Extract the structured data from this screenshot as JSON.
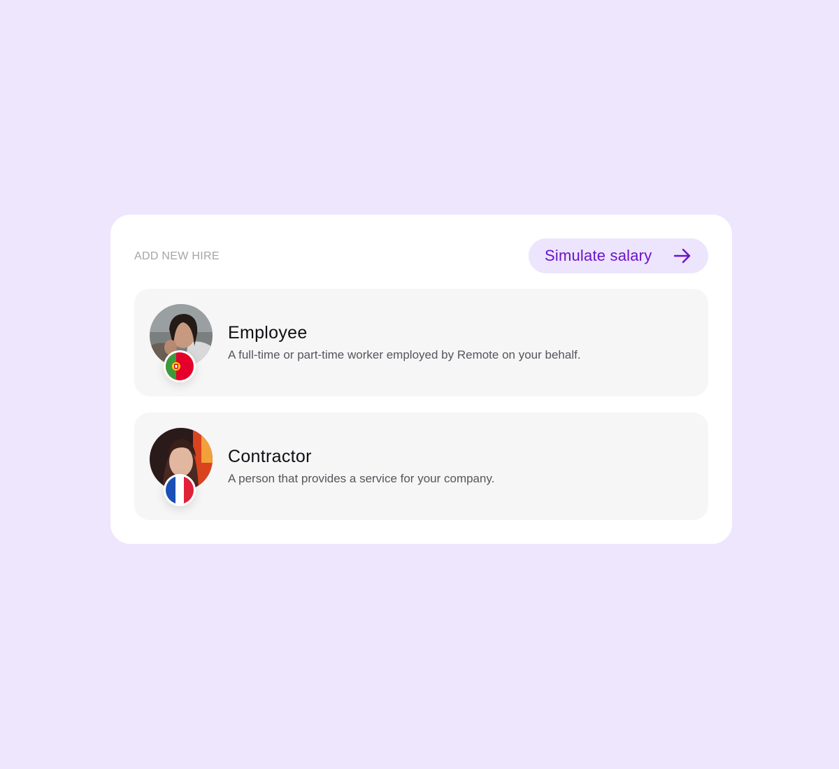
{
  "header": {
    "title": "ADD NEW HIRE",
    "simulate_label": "Simulate salary",
    "simulate_icon": "arrow-right-icon"
  },
  "options": [
    {
      "title": "Employee",
      "description": "A full-time or part-time worker employed by Remote on your behalf.",
      "flag": "portugal-flag-icon"
    },
    {
      "title": "Contractor",
      "description": "A person that provides a service for your company.",
      "flag": "france-flag-icon"
    }
  ],
  "colors": {
    "background": "#ede6fd",
    "card": "#ffffff",
    "option_bg": "#f6f6f6",
    "accent": "#6b12c9",
    "button_bg": "#ece5fd"
  }
}
